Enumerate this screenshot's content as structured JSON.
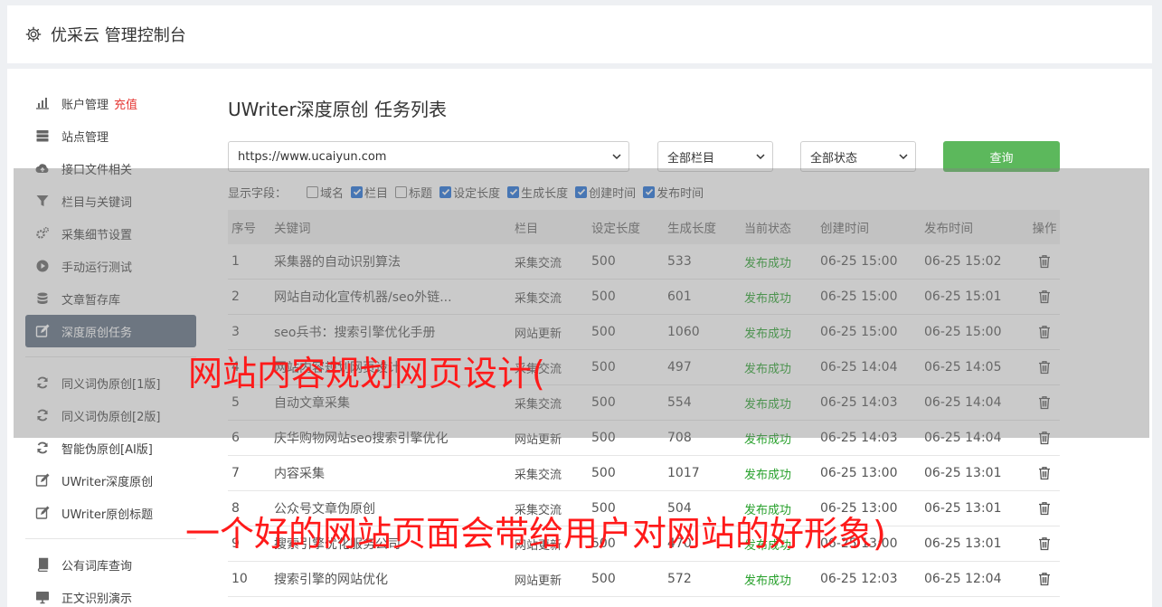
{
  "header": {
    "title": "优采云 管理控制台"
  },
  "sidebar": {
    "items": [
      {
        "label": "账户管理",
        "badge": "充值",
        "icon": "bar-chart-icon"
      },
      {
        "label": "站点管理",
        "icon": "server-icon"
      },
      {
        "label": "接口文件相关",
        "icon": "cloud-upload-icon"
      },
      {
        "label": "栏目与关键词",
        "icon": "filter-icon"
      },
      {
        "label": "采集细节设置",
        "icon": "cogs-icon"
      },
      {
        "label": "手动运行测试",
        "icon": "play-circle-icon"
      },
      {
        "label": "文章暂存库",
        "icon": "database-icon"
      },
      {
        "label": "深度原创任务",
        "icon": "edit-icon",
        "active": true
      },
      {
        "label": "同义词伪原创[1版]",
        "icon": "refresh-icon"
      },
      {
        "label": "同义词伪原创[2版]",
        "icon": "refresh-icon"
      },
      {
        "label": "智能伪原创[AI版]",
        "icon": "refresh-icon"
      },
      {
        "label": "UWriter深度原创",
        "icon": "edit-icon"
      },
      {
        "label": "UWriter原创标题",
        "icon": "edit-icon"
      },
      {
        "label": "公有词库查询",
        "icon": "book-icon"
      },
      {
        "label": "正文识别演示",
        "icon": "monitor-icon"
      }
    ]
  },
  "main": {
    "title": "UWriter深度原创 任务列表",
    "filters": {
      "site": "https://www.ucaiyun.com",
      "column": "全部栏目",
      "status": "全部状态",
      "query_label": "查询"
    },
    "fields_label": "显示字段：",
    "fields": [
      {
        "label": "域名",
        "checked": false
      },
      {
        "label": "栏目",
        "checked": true
      },
      {
        "label": "标题",
        "checked": false
      },
      {
        "label": "设定长度",
        "checked": true
      },
      {
        "label": "生成长度",
        "checked": true
      },
      {
        "label": "创建时间",
        "checked": true
      },
      {
        "label": "发布时间",
        "checked": true
      }
    ],
    "table": {
      "headers": [
        "序号",
        "关键词",
        "栏目",
        "设定长度",
        "生成长度",
        "当前状态",
        "创建时间",
        "发布时间",
        "操作"
      ],
      "rows": [
        [
          "1",
          "采集器的自动识别算法",
          "采集交流",
          "500",
          "533",
          "发布成功",
          "06-25 15:00",
          "06-25 15:02"
        ],
        [
          "2",
          "网站自动化宣传机器/seo外链...",
          "采集交流",
          "500",
          "601",
          "发布成功",
          "06-25 15:00",
          "06-25 15:01"
        ],
        [
          "3",
          "seo兵书：搜索引擎优化手册",
          "网站更新",
          "500",
          "1060",
          "发布成功",
          "06-25 15:00",
          "06-25 15:00"
        ],
        [
          "4",
          "网站内容规划网页设计",
          "采集交流",
          "500",
          "497",
          "发布成功",
          "06-25 14:04",
          "06-25 14:05"
        ],
        [
          "5",
          "自动文章采集",
          "采集交流",
          "500",
          "554",
          "发布成功",
          "06-25 14:03",
          "06-25 14:04"
        ],
        [
          "6",
          "庆华购物网站seo搜索引擎优化",
          "网站更新",
          "500",
          "708",
          "发布成功",
          "06-25 14:03",
          "06-25 14:04"
        ],
        [
          "7",
          "内容采集",
          "采集交流",
          "500",
          "1017",
          "发布成功",
          "06-25 13:00",
          "06-25 13:01"
        ],
        [
          "8",
          "公众号文章伪原创",
          "采集交流",
          "500",
          "504",
          "发布成功",
          "06-25 13:00",
          "06-25 13:01"
        ],
        [
          "9",
          "搜索引擎优化服务公司",
          "网站更新",
          "500",
          "470",
          "发布成功",
          "06-25 13:00",
          "06-25 13:01"
        ],
        [
          "10",
          "搜索引擎的网站优化",
          "网站更新",
          "500",
          "572",
          "发布成功",
          "06-25 12:03",
          "06-25 12:04"
        ]
      ]
    }
  },
  "watermark": {
    "line1": "网站内容规划网页设计(",
    "line2": "一个好的网站页面会带给用户对网站的好形象)"
  },
  "colors": {
    "accent_green": "#5cb85c",
    "active_item": "#5f6f82",
    "status_ok": "#27a02b",
    "badge_red": "#e53935",
    "watermark": "#ff1a1a"
  }
}
